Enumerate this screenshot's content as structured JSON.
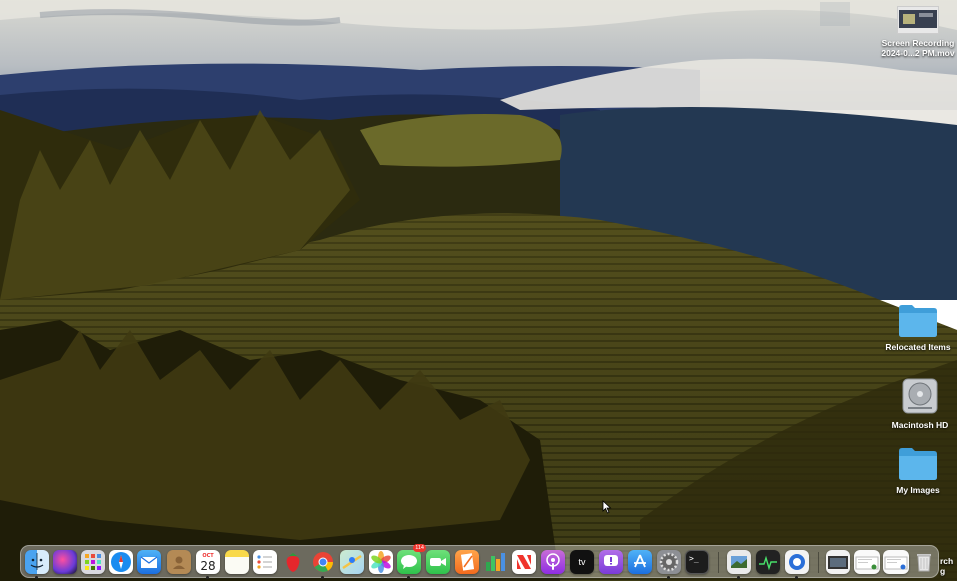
{
  "desktop": {
    "items": [
      {
        "name": "screen-recording-file",
        "label_line1": "Screen Recording",
        "label_line2": "2024-0...2 PM.mov"
      },
      {
        "name": "relocated-items-folder",
        "label": "Relocated Items"
      },
      {
        "name": "macintosh-hd-drive",
        "label": "Macintosh HD"
      },
      {
        "name": "my-images-folder",
        "label": "My Images"
      }
    ],
    "partial_file_label_line1": "rch",
    "partial_file_label_line2": "g"
  },
  "dock": {
    "calendar": {
      "month": "OCT",
      "day": "28"
    },
    "messages_badge": "114",
    "icons": [
      "finder-icon",
      "siri-icon",
      "launchpad-icon",
      "safari-icon",
      "mail-icon",
      "contacts-icon",
      "calendar-icon",
      "notes-icon",
      "reminders-icon",
      "strawberry-app-icon",
      "chrome-icon",
      "maps-icon",
      "photos-icon",
      "messages-icon",
      "facetime-icon",
      "pages-icon",
      "numbers-icon",
      "news-icon",
      "podcasts-icon",
      "tv-icon",
      "feedback-icon",
      "app-store-icon",
      "system-settings-icon",
      "terminal-icon",
      "preview-icon",
      "activity-monitor-icon",
      "proxyman-icon",
      "screenshot-folder-icon",
      "documents-stack-icon",
      "downloads-stack-icon",
      "trash-icon"
    ],
    "tv_label": "tv"
  }
}
